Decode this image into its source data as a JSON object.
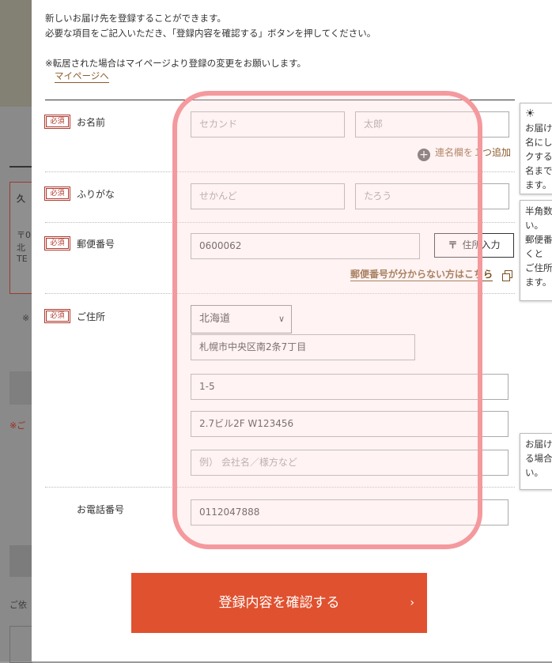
{
  "intro": {
    "line1": "新しいお届け先を登録することができます。",
    "line2": "必要な項目をご記入いただき、「登録内容を確認する」ボタンを押してください。",
    "line3": "※転居された場合はマイページより登録の変更をお願いします。",
    "mypage_link": "マイページへ"
  },
  "badge_required": "必須",
  "fields": {
    "name": {
      "label": "お名前",
      "last": "セカンド",
      "first": "太郎",
      "add_link": "連名欄を１つ追加"
    },
    "kana": {
      "label": "ふりがな",
      "last": "せかんど",
      "first": "たろう"
    },
    "zip": {
      "label": "郵便番号",
      "value": "0600062",
      "button": "住所入力",
      "button_icon": "〒",
      "help_link": "郵便番号が分からない方はこちら"
    },
    "address": {
      "label": "ご住所",
      "prefecture": "北海道",
      "city": "札幌市中央区南2条7丁目",
      "line1": "1-5",
      "line2": "2.7ビル2F W123456",
      "line3_placeholder": "例） 会社名／様方など"
    },
    "phone": {
      "label": "お電話番号",
      "value": "0112047888"
    }
  },
  "tips": {
    "name": [
      "お届け",
      "名にし",
      "クする",
      "名まで",
      "ます。"
    ],
    "kana": [
      "半角数",
      "い。",
      "郵便番",
      "くと",
      "ご住所",
      "ます。"
    ],
    "address": [
      "お届け",
      "る場合",
      "い。"
    ]
  },
  "submit_label": "登録内容を確認する",
  "background_page": {
    "card_title": "久",
    "card_lines": [
      "〒0",
      "北",
      "TE"
    ],
    "note_mark": "※",
    "red_text": "※ご",
    "bottom_text": "ご依"
  }
}
